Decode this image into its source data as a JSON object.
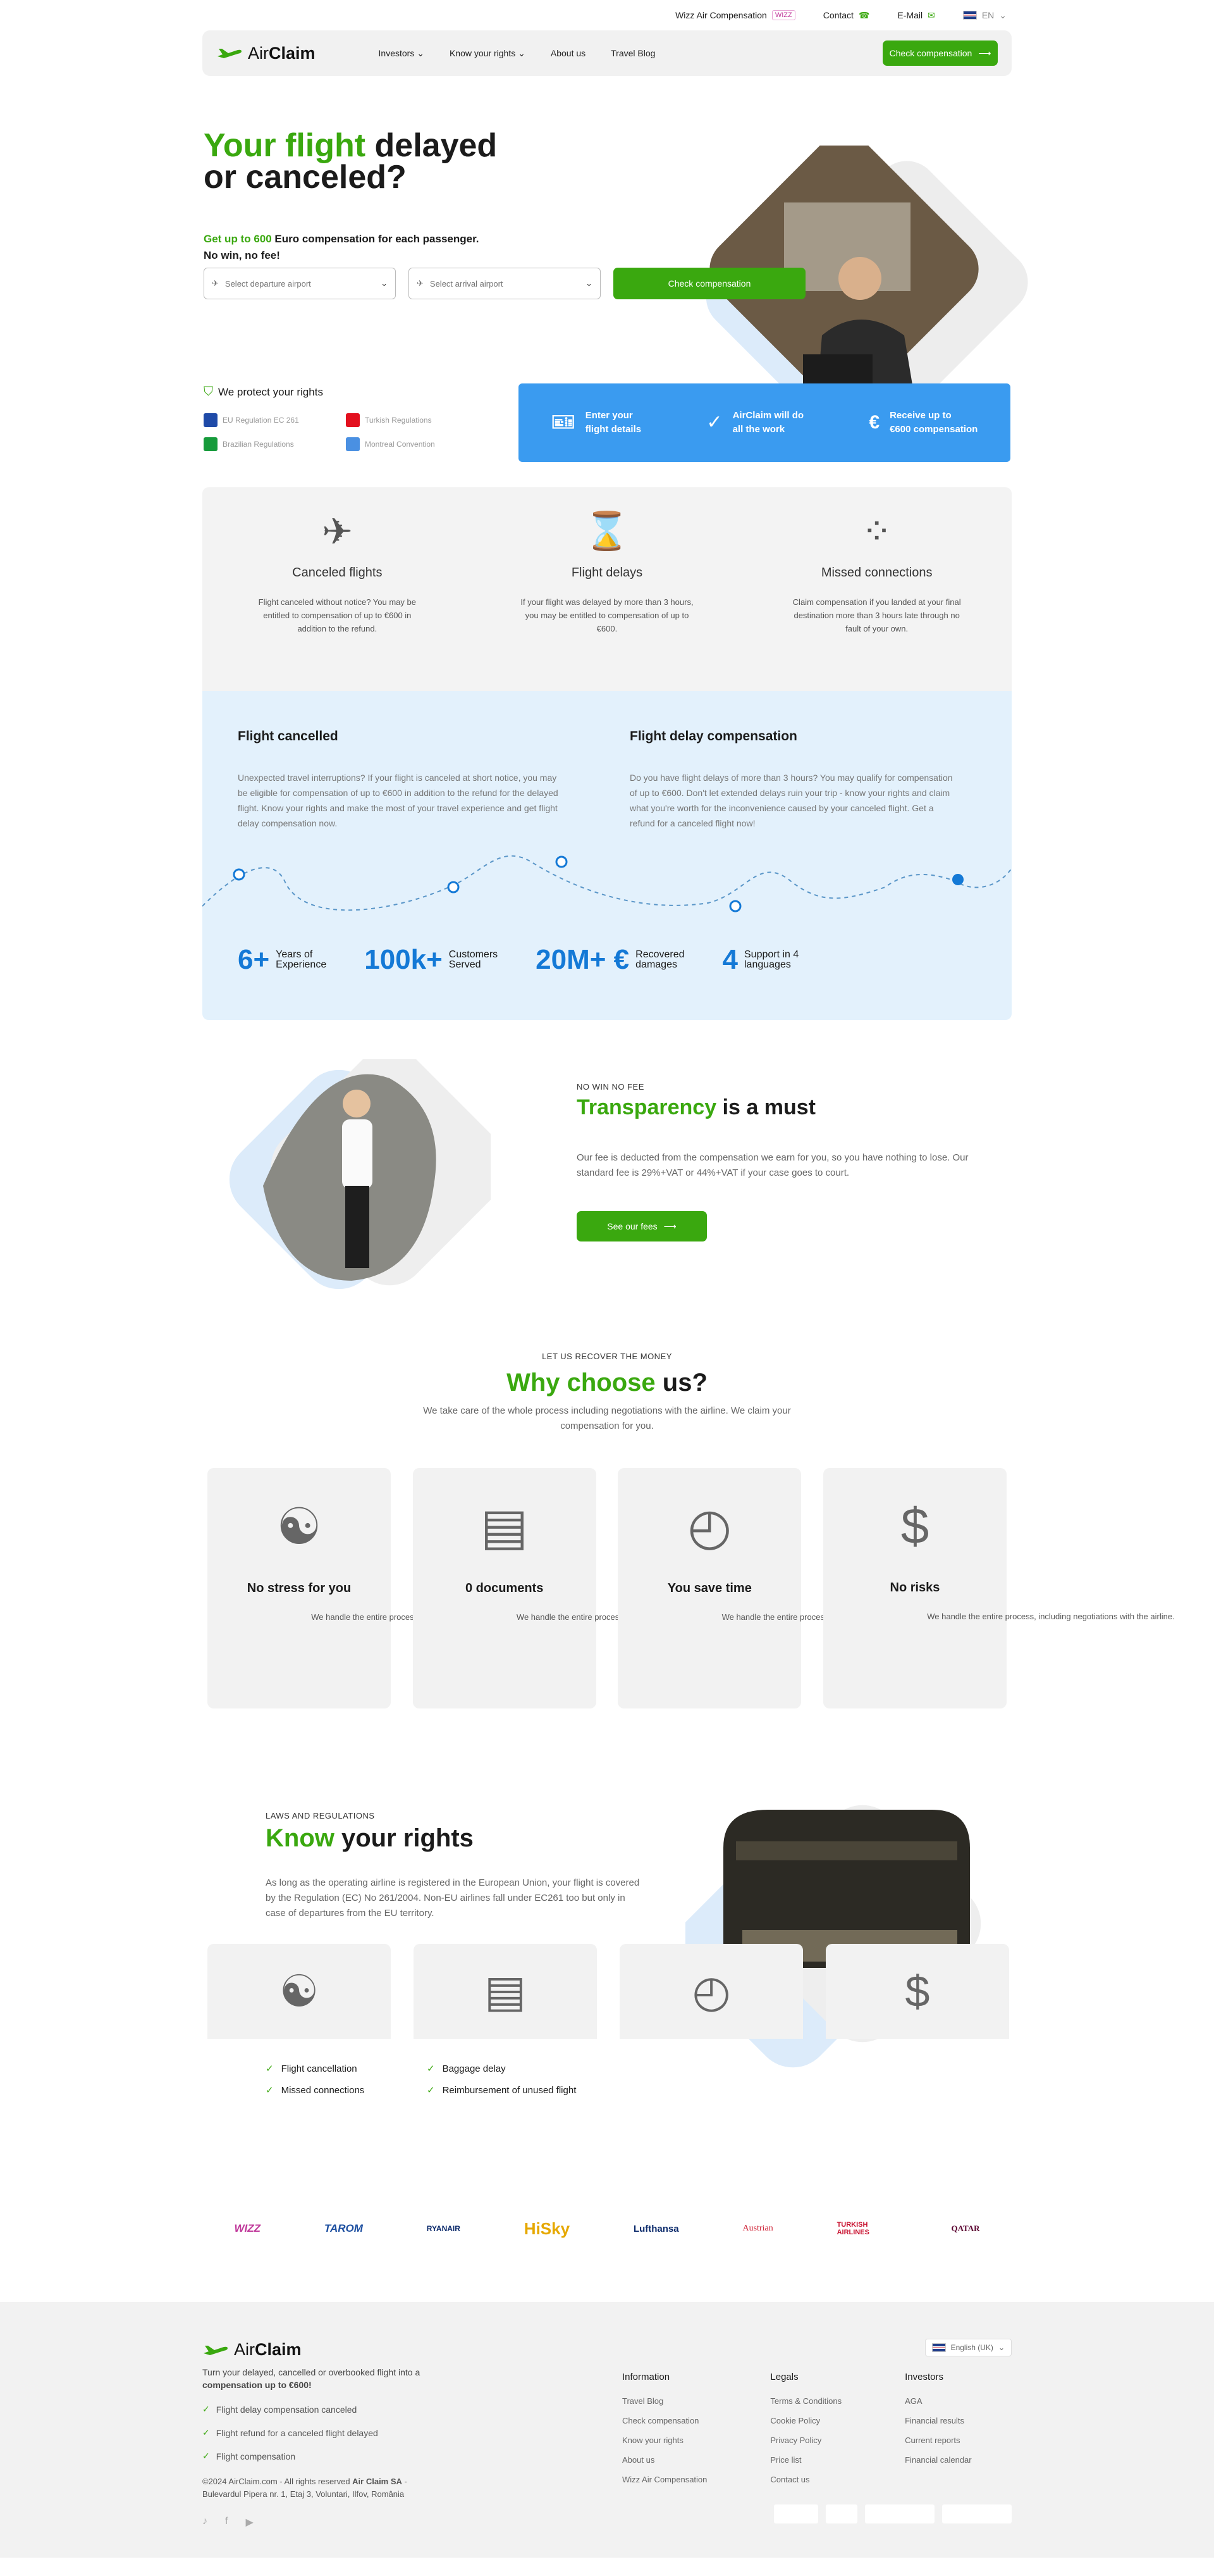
{
  "topbar": {
    "airline_link": "Wizz Air Compensation",
    "airline_tag": "WIZZ",
    "contact": "Contact",
    "email": "E-Mail",
    "lang": "EN"
  },
  "nav": {
    "logo_air": "Air",
    "logo_claim": "Claim",
    "links": [
      "Investors",
      "Know your rights",
      "About us",
      "Travel Blog"
    ],
    "cta": "Check compensation"
  },
  "hero": {
    "title_green": "Your flight",
    "title_rest": " delayed or canceled?",
    "sub_green": "Get up to 600",
    "sub_rest": " Euro compensation for each passenger.",
    "sub2": "No win, no fee!",
    "dep_placeholder": "Select departure airport",
    "arr_placeholder": "Select arrival airport",
    "cta": "Check compensation",
    "protect_title": "We protect your rights",
    "regs": [
      "EU Regulation EC 261",
      "Turkish Regulations",
      "Brazilian Regulations",
      "Montreal Convention"
    ],
    "steps": [
      [
        "Enter your",
        "flight details"
      ],
      [
        "AirClaim will do",
        "all the work"
      ],
      [
        "Receive up to",
        "€600 compensation"
      ]
    ]
  },
  "cases": [
    {
      "title": "Canceled flights",
      "text": "Flight canceled without notice? You may be entitled to compensation of up to €600 in addition to the refund."
    },
    {
      "title": "Flight delays",
      "text": "If your flight was delayed by more than 3 hours, you may be entitled to compensation of up to €600."
    },
    {
      "title": "Missed connections",
      "text": "Claim compensation if you landed at your final destination more than 3 hours late through no fault of your own."
    }
  ],
  "info": {
    "left_title": "Flight cancelled",
    "left_text": "Unexpected travel interruptions? If your flight is canceled at short notice, you may be eligible for compensation of up to €600 in addition to the refund for the delayed flight. Know your rights and make the most of your travel experience and get flight delay compensation now.",
    "right_title": "Flight delay compensation",
    "right_text": "Do you have flight delays of more than 3 hours? You may qualify for compensation of up to €600. Don't let extended delays ruin your trip - know your rights and claim what you're worth for the inconvenience caused by your canceled flight. Get a refund for a canceled flight now!"
  },
  "stats": [
    {
      "num": "6+",
      "label1": "Years of",
      "label2": "Experience"
    },
    {
      "num": "100k+",
      "label1": "Customers",
      "label2": "Served"
    },
    {
      "num": "20M+ €",
      "label1": "Recovered",
      "label2": "damages"
    },
    {
      "num": "4",
      "label1": "Support in 4",
      "label2": "languages"
    }
  ],
  "transparency": {
    "over": "NO WIN NO FEE",
    "title_green": "Transparency",
    "title_rest": " is a must",
    "text": "Our fee is deducted from the compensation we earn for you, so you have nothing to lose. Our standard fee is 29%+VAT or 44%+VAT if your case goes to court.",
    "btn": "See our fees"
  },
  "why": {
    "over": "LET US RECOVER THE MONEY",
    "title_green": "Why choose",
    "title_rest": " us?",
    "text": "We take care of the whole process including negotiations with the airline. We claim your compensation for you.",
    "cards": [
      {
        "title": "No stress for you",
        "text": "We handle the entire process, including negotiations with the airline."
      },
      {
        "title": "0 documents",
        "text": "We handle the entire process, including negotiations with the airline."
      },
      {
        "title": "You save time",
        "text": "We handle the entire process, including negotiations with the airline."
      },
      {
        "title": "No risks",
        "text": "We handle the entire process, including negotiations with the airline."
      }
    ]
  },
  "laws": {
    "over": "LAWS AND REGULATIONS",
    "title_green": "Know",
    "title_rest": " your rights",
    "text": "As long as the operating airline is registered in the European Union, your flight is covered by the Regulation (EC) No 261/2004. Non-EU airlines fall under EC261 too but only in case of departures from the EU territory.",
    "checks": [
      "Flight cancellation",
      "Baggage delay",
      "Missed connections",
      "Reimbursement of unused flight"
    ]
  },
  "airlines": [
    "WIZZ",
    "TAROM",
    "RYANAIR",
    "HiSky",
    "Lufthansa",
    "Austrian",
    "TURKISH AIRLINES",
    "QATAR"
  ],
  "footer": {
    "tagline": "Turn your delayed, cancelled or overbooked flight into a ",
    "tagline_bold": "compensation up to €600!",
    "checks": [
      "Flight delay compensation canceled",
      "Flight refund for a canceled flight delayed",
      "Flight compensation"
    ],
    "copy": "©2024 AirClaim.com - All rights reserved ",
    "copy_bold": "Air Claim SA",
    "copy_tail": " - Bulevardul Pipera nr. 1, Etaj 3, Voluntari, Ilfov, România",
    "lang": "English (UK)",
    "cols": [
      {
        "title": "Information",
        "items": [
          "Travel Blog",
          "Check compensation",
          "Know your rights",
          "About us",
          "Wizz Air Compensation"
        ]
      },
      {
        "title": "Legals",
        "items": [
          "Terms & Conditions",
          "Cookie Policy",
          "Privacy Policy",
          "Price list",
          "Contact us"
        ]
      },
      {
        "title": "Investors",
        "items": [
          "AGA",
          "Financial results",
          "Current reports",
          "Financial calendar"
        ]
      }
    ]
  },
  "colors": {
    "green": "#3aa80f",
    "blue": "#1479d6",
    "steps_bg": "#3a9bf0",
    "light_blue": "#e3f1fc"
  }
}
